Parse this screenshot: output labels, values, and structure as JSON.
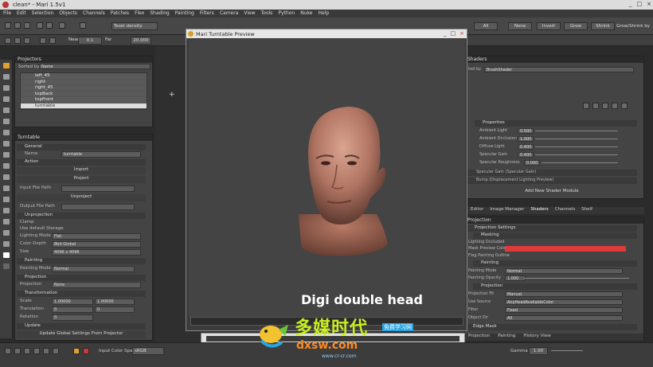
{
  "window": {
    "title": "clean* - Mari 1.5v1",
    "controls": [
      "_",
      "□",
      "×"
    ]
  },
  "menu": [
    "File",
    "Edit",
    "Selection",
    "Objects",
    "Channels",
    "Patches",
    "Flex",
    "Shading",
    "Painting",
    "Filters",
    "Camera",
    "View",
    "Tools",
    "Python",
    "Nuke",
    "Help"
  ],
  "toolbar": {
    "texel_density": "Texel density",
    "near_label": "Near",
    "near_value": "0.1",
    "far_label": "Far",
    "far_value": "20.000",
    "buttons": [
      "All",
      "None",
      "Invert",
      "Grow",
      "Shrink",
      "Grow/Shrink by"
    ]
  },
  "projectors": {
    "title": "Projectors",
    "sorted_by_label": "Sorted by",
    "sorted_by_value": "Name",
    "items": [
      {
        "label": "left_45",
        "selected": false
      },
      {
        "label": "right",
        "selected": false
      },
      {
        "label": "right_45",
        "selected": false
      },
      {
        "label": "topBack",
        "selected": false
      },
      {
        "label": "topFront",
        "selected": false
      },
      {
        "label": "turntable",
        "selected": true
      }
    ]
  },
  "turntable": {
    "title": "Turntable",
    "general": "General",
    "name_label": "Name",
    "name_value": "turntable",
    "action": "Action",
    "import": "Import",
    "project": "Project",
    "input_file_label": "Input File Path",
    "unproject": "Unproject",
    "output_file_label": "Output File Path",
    "unprojection": "Unprojection",
    "clamp_label": "Clamp",
    "use_default_label": "Use default Storage",
    "lighting_mode_label": "Lighting Mode",
    "lighting_mode_value": "Flat",
    "color_depth_label": "Color Depth",
    "color_depth_value": "8bit Global",
    "size_label": "Size",
    "size_value": "4096 x 4096",
    "painting": "Painting",
    "painting_mode_label": "Painting Mode",
    "painting_mode_value": "Normal",
    "projection": "Projection",
    "projection_label": "Projection",
    "projection_value": "None",
    "transformation": "Transformation",
    "scale_label": "Scale",
    "scale_value": "1.00000",
    "scale_value2": "1.00000",
    "translation_label": "Translation",
    "translation_value": "0",
    "translation_value2": "0",
    "rotation_label": "Rotation",
    "rotation_value": "0",
    "update": "Update",
    "update_button": "Update Global Settings From Projector"
  },
  "shaders_panel": {
    "title": "Shaders",
    "selected_label": "ted by",
    "selected_value": "BrushShader",
    "props_title": "Properties",
    "props": [
      {
        "label": "Ambient Light",
        "value": "0.500"
      },
      {
        "label": "Ambient Occlusion",
        "value": "1.000"
      },
      {
        "label": "Diffuse Light",
        "value": "0.400"
      },
      {
        "label": "Specular Gain",
        "value": "0.400"
      },
      {
        "label": "Specular Roughness",
        "value": "0.000"
      }
    ],
    "specular_gain_row": "Specular Gain (Specular Gain)",
    "bump_row": "Bump (Displacement Lighting Preview)",
    "add_module": "Add New Shader Module",
    "tabs": [
      "Editor",
      "Image Manager",
      "Shaders",
      "Channels",
      "Shelf"
    ]
  },
  "projection_panel": {
    "title": "Projection",
    "section1": "Projection Settings",
    "masking": "Masking",
    "lighting_occluded_label": "Lighting Occluded",
    "mask_preview_label": "Mask Preview Color",
    "mask_preview_color": "#e03a3a",
    "flag_painting": "Flag Painting Outline",
    "painting": "Painting",
    "painting_mode_label": "Painting Mode",
    "painting_mode_value": "Normal",
    "painting_opacity_label": "Painting Opacity",
    "painting_opacity_value": "1.000",
    "projection": "Projection",
    "projection_fit_label": "Projection Fit",
    "projection_fit_value": "Manual",
    "use_source_label": "Use Source",
    "use_source_value": "AnyHeadAvailableColor",
    "filter_label": "Filter",
    "filter_value": "Fixed",
    "object_dir_label": "Object Dir",
    "object_dir_value": "All",
    "edge_mask": "Edge Mask",
    "tabs": [
      "Projection",
      "Painting",
      "History View"
    ]
  },
  "dialog": {
    "title": "Mari Turntable Preview",
    "caption": "Digi double head",
    "controls": [
      "_",
      "□",
      "×"
    ]
  },
  "status": {
    "input_color_label": "Input Color Space",
    "input_color_value": "sRGB",
    "gamma_label": "Gamma",
    "gamma_value": "1.00"
  },
  "watermark": {
    "title": "多媒时代",
    "tag": "免费学习网",
    "sub": "dxsw.com",
    "url": "www.cr-cr.com"
  },
  "colors": {
    "accent_red": "#e03a3a",
    "panel": "#444444",
    "title_bar": "#e6e6e6"
  }
}
